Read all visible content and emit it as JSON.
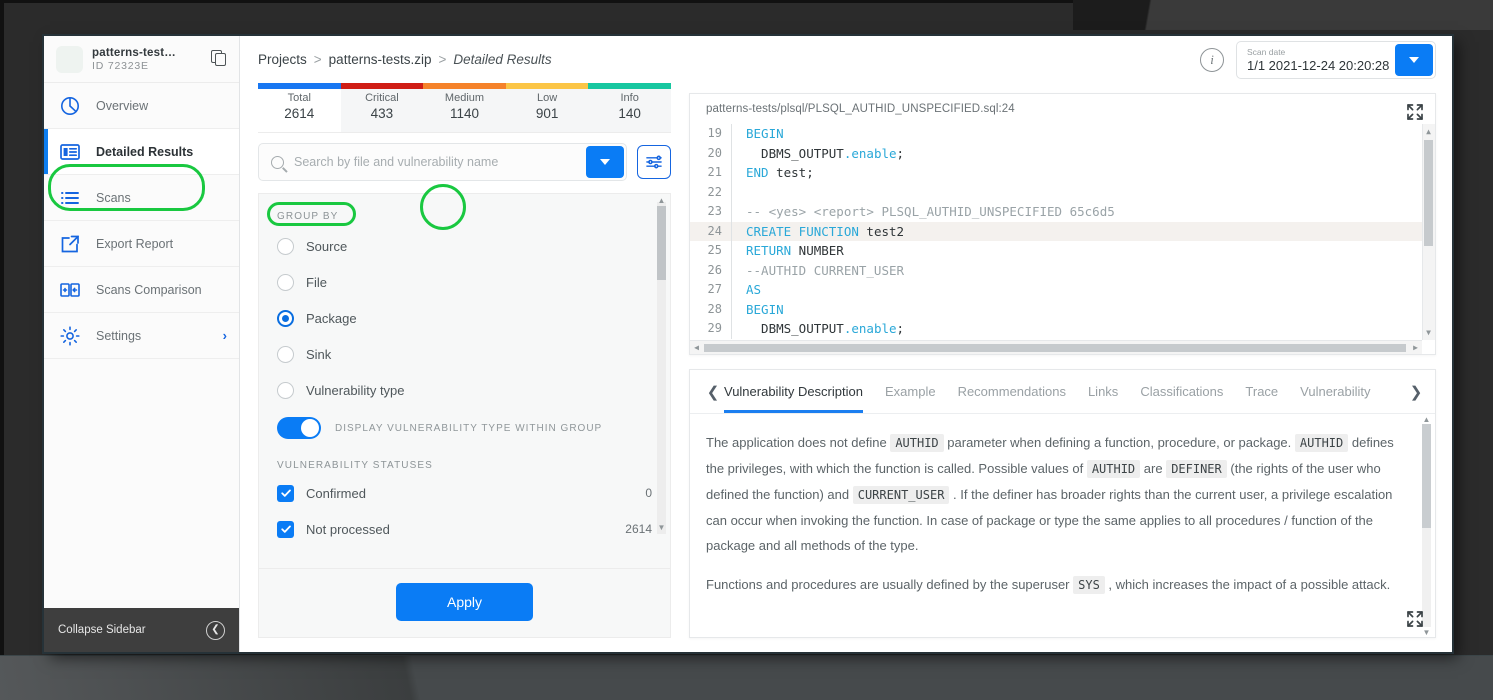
{
  "sidebar": {
    "project": {
      "name": "patterns-test…",
      "id": "ID 72323E",
      "copy_icon": "copy-icon"
    },
    "items": [
      {
        "label": "Overview",
        "icon": "pie-chart-icon"
      },
      {
        "label": "Detailed Results",
        "icon": "detailed-results-icon"
      },
      {
        "label": "Scans",
        "icon": "list-icon"
      },
      {
        "label": "Export Report",
        "icon": "export-icon"
      },
      {
        "label": "Scans Comparison",
        "icon": "compare-icon"
      },
      {
        "label": "Settings",
        "icon": "gear-icon"
      }
    ],
    "collapse": {
      "label": "Collapse Sidebar",
      "icon": "chevron-left-circle-icon"
    }
  },
  "topbar": {
    "breadcrumb": {
      "root": "Projects",
      "sep1": ">",
      "project": "patterns-tests.zip",
      "sep2": ">",
      "current": "Detailed Results"
    },
    "info_icon": "info-icon",
    "scan_select": {
      "label": "Scan date",
      "value": "1/1 2021-12-24 20:20:28",
      "caret_icon": "caret-down-icon"
    }
  },
  "severity": {
    "cells": [
      {
        "name": "Total",
        "count": "2614",
        "color": "#1877f2"
      },
      {
        "name": "Critical",
        "count": "433",
        "color": "#cf1d15"
      },
      {
        "name": "Medium",
        "count": "1140",
        "color": "#f5822a"
      },
      {
        "name": "Low",
        "count": "901",
        "color": "#fbc546"
      },
      {
        "name": "Info",
        "count": "140",
        "color": "#17c7a0"
      }
    ]
  },
  "search": {
    "placeholder": "Search by file and vulnerability name",
    "value": "",
    "magnifier_icon": "search-icon",
    "dropdown_icon": "caret-down-icon",
    "filter_icon": "filter-sliders-icon"
  },
  "filter_panel": {
    "group_by_title": "GROUP BY",
    "group_by_options": [
      {
        "label": "Source",
        "selected": false
      },
      {
        "label": "File",
        "selected": false
      },
      {
        "label": "Package",
        "selected": true
      },
      {
        "label": "Sink",
        "selected": false
      },
      {
        "label": "Vulnerability type",
        "selected": false
      }
    ],
    "toggle": {
      "label": "DISPLAY VULNERABILITY TYPE WITHIN GROUP",
      "on": true
    },
    "statuses_title": "VULNERABILITY STATUSES",
    "statuses": [
      {
        "label": "Confirmed",
        "count": "0",
        "checked": true
      },
      {
        "label": "Not processed",
        "count": "2614",
        "checked": true
      }
    ],
    "apply_label": "Apply"
  },
  "code_viewer": {
    "path": "patterns-tests/plsql/PLSQL_AUTHID_UNSPECIFIED.sql:24",
    "expand_icon": "expand-icon",
    "lines": [
      {
        "n": "19",
        "hl": false,
        "html": "<span class=\"kw\">BEGIN</span>"
      },
      {
        "n": "20",
        "hl": false,
        "html": "  DBMS_OUTPUT<span class=\"mth\">.enable</span>;"
      },
      {
        "n": "21",
        "hl": false,
        "html": "<span class=\"kw\">END</span> test;"
      },
      {
        "n": "22",
        "hl": false,
        "html": ""
      },
      {
        "n": "23",
        "hl": false,
        "html": "<span class=\"cm\">-- &lt;yes&gt; &lt;report&gt; PLSQL_AUTHID_UNSPECIFIED 65c6d5</span>"
      },
      {
        "n": "24",
        "hl": true,
        "html": "<span class=\"kw\">CREATE FUNCTION</span> test2"
      },
      {
        "n": "25",
        "hl": false,
        "html": "<span class=\"kw\">RETURN</span> NUMBER"
      },
      {
        "n": "26",
        "hl": false,
        "html": "<span class=\"cm\">--AUTHID CURRENT_USER</span>"
      },
      {
        "n": "27",
        "hl": false,
        "html": "<span class=\"kw\">AS</span>"
      },
      {
        "n": "28",
        "hl": false,
        "html": "<span class=\"kw\">BEGIN</span>"
      },
      {
        "n": "29",
        "hl": false,
        "html": "  DBMS_OUTPUT<span class=\"mth\">.enable</span>;"
      }
    ]
  },
  "details": {
    "prev_icon": "chevron-left-icon",
    "next_icon": "chevron-right-icon",
    "expand_icon": "expand-icon",
    "tabs": [
      {
        "label": "Vulnerability Description",
        "active": true
      },
      {
        "label": "Example",
        "active": false
      },
      {
        "label": "Recommendations",
        "active": false
      },
      {
        "label": "Links",
        "active": false
      },
      {
        "label": "Classifications",
        "active": false
      },
      {
        "label": "Trace",
        "active": false
      },
      {
        "label": "Vulnerability",
        "active": false
      }
    ],
    "paragraphs": [
      "The application does not define <code class=\"inl\">AUTHID</code> parameter when defining a function, procedure, or package. <code class=\"inl\">AUTHID</code> defines the privileges, with which the function is called. Possible values of <code class=\"inl\">AUTHID</code> are <code class=\"inl\">DEFINER</code> (the rights of the user who defined the function) and <code class=\"inl\">CURRENT_USER</code> . If the definer has broader rights than the current user, a privilege escalation can occur when invoking the function. In case of package or type the same applies to all procedures / function of the package and all methods of the type.",
      "Functions and procedures are usually defined by the superuser <code class=\"inl\">SYS</code> , which increases the impact of a possible attack."
    ]
  },
  "highlights": {
    "accent_green": "#19c840",
    "accent_blue": "#0a7cf5"
  }
}
